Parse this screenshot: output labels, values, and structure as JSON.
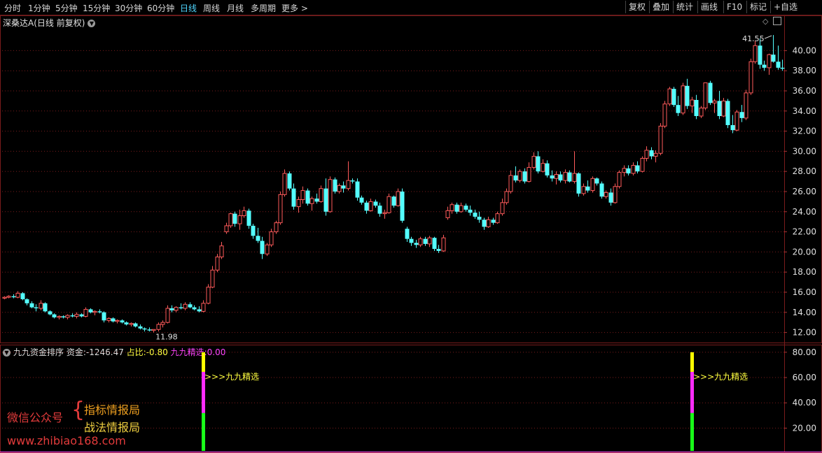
{
  "toolbar": {
    "periods": [
      "分时",
      "1分钟",
      "5分钟",
      "15分钟",
      "30分钟",
      "60分钟",
      "日线",
      "周线",
      "月线",
      "多周期",
      "更多 >"
    ],
    "active_index": 6,
    "right_buttons": [
      "复权",
      "叠加",
      "统计",
      "画线",
      "F10",
      "标记",
      "+自选"
    ]
  },
  "main_title": {
    "name": "深桑达A",
    "mode": "(日线 前复权)"
  },
  "indicator": {
    "name": "九九资金排序",
    "zijin_label": "资金:",
    "zijin_value": "-1246.47",
    "zhanbi_label": "占比:",
    "zhanbi_value": "-0.80",
    "jingxuan_label": "九九精选:",
    "jingxuan_value": "0.00",
    "signal_text": ">>>九九精选"
  },
  "watermark": {
    "left": "微信公众号",
    "brace": "{",
    "line1": "指标情报局",
    "line2": "战法情报局",
    "url": "www.zhibiao168.com"
  },
  "colors": {
    "up": "#ff5a5a",
    "down": "#54ffff",
    "grid": "#7a1c1c",
    "active_tab": "#4fd6ff"
  },
  "chart_data": [
    {
      "type": "candlestick",
      "title": "深桑达A (日线 前复权)",
      "y_ticks": [
        "12.00",
        "14.00",
        "16.00",
        "18.00",
        "20.00",
        "22.00",
        "24.00",
        "26.00",
        "28.00",
        "30.00",
        "32.00",
        "34.00",
        "36.00",
        "38.00",
        "40.00"
      ],
      "ylim": [
        11,
        43.5
      ],
      "annotations": {
        "high": "41.55",
        "low": "11.98"
      },
      "candles": [
        [
          15.4,
          15.6,
          15.3,
          15.5
        ],
        [
          15.5,
          15.7,
          15.4,
          15.6
        ],
        [
          15.6,
          15.8,
          15.4,
          15.5
        ],
        [
          15.5,
          16.1,
          15.4,
          15.9
        ],
        [
          15.9,
          16.0,
          15.2,
          15.3
        ],
        [
          15.3,
          15.4,
          14.7,
          14.9
        ],
        [
          14.9,
          15.1,
          14.4,
          14.5
        ],
        [
          14.5,
          14.8,
          14.1,
          14.4
        ],
        [
          14.4,
          15.2,
          14.2,
          14.9
        ],
        [
          14.9,
          15.0,
          14.0,
          14.1
        ],
        [
          14.1,
          14.2,
          13.7,
          13.8
        ],
        [
          13.8,
          13.9,
          13.4,
          13.5
        ],
        [
          13.5,
          13.7,
          13.3,
          13.6
        ],
        [
          13.6,
          13.7,
          13.4,
          13.5
        ],
        [
          13.5,
          13.8,
          13.3,
          13.7
        ],
        [
          13.7,
          13.9,
          13.5,
          13.6
        ],
        [
          13.6,
          14.0,
          13.4,
          13.8
        ],
        [
          13.8,
          13.9,
          13.5,
          13.6
        ],
        [
          13.6,
          14.5,
          13.5,
          14.3
        ],
        [
          14.3,
          14.4,
          13.9,
          14.0
        ],
        [
          14.0,
          14.2,
          13.7,
          14.1
        ],
        [
          14.1,
          14.3,
          13.9,
          14.0
        ],
        [
          14.0,
          14.1,
          13.0,
          13.2
        ],
        [
          13.2,
          13.5,
          13.0,
          13.4
        ],
        [
          13.4,
          13.5,
          13.0,
          13.1
        ],
        [
          13.1,
          13.3,
          12.9,
          13.2
        ],
        [
          13.2,
          13.3,
          12.9,
          13.0
        ],
        [
          13.0,
          13.1,
          12.7,
          12.8
        ],
        [
          12.8,
          13.0,
          12.6,
          12.9
        ],
        [
          12.9,
          13.0,
          12.5,
          12.6
        ],
        [
          12.6,
          12.8,
          12.3,
          12.4
        ],
        [
          12.4,
          12.5,
          12.1,
          12.3
        ],
        [
          12.3,
          12.5,
          12.1,
          12.2
        ],
        [
          12.2,
          12.3,
          12.0,
          12.3
        ],
        [
          12.3,
          13.0,
          12.1,
          12.8
        ],
        [
          12.8,
          13.2,
          12.5,
          13.0
        ],
        [
          13.0,
          14.7,
          12.9,
          14.4
        ],
        [
          14.4,
          14.7,
          14.0,
          14.2
        ],
        [
          14.2,
          14.6,
          14.0,
          14.5
        ],
        [
          14.5,
          14.9,
          14.3,
          14.4
        ],
        [
          14.4,
          15.0,
          14.2,
          14.8
        ],
        [
          14.8,
          15.0,
          14.4,
          14.5
        ],
        [
          14.5,
          14.7,
          14.2,
          14.3
        ],
        [
          14.3,
          14.6,
          14.0,
          14.1
        ],
        [
          14.1,
          15.2,
          14.0,
          14.9
        ],
        [
          14.9,
          16.8,
          14.8,
          16.5
        ],
        [
          16.5,
          18.6,
          16.4,
          18.2
        ],
        [
          18.2,
          19.8,
          18.0,
          19.5
        ],
        [
          19.5,
          21.0,
          19.3,
          20.6
        ],
        [
          22.0,
          22.9,
          21.8,
          22.6
        ],
        [
          22.6,
          23.9,
          22.4,
          23.8
        ],
        [
          23.8,
          24.0,
          22.5,
          22.8
        ],
        [
          22.8,
          24.2,
          22.2,
          23.6
        ],
        [
          23.6,
          24.5,
          23.4,
          24.1
        ],
        [
          24.1,
          24.3,
          22.3,
          22.6
        ],
        [
          22.6,
          22.8,
          21.3,
          21.6
        ],
        [
          21.6,
          22.4,
          20.9,
          21.1
        ],
        [
          21.1,
          21.5,
          19.3,
          19.8
        ],
        [
          19.8,
          20.9,
          19.6,
          20.7
        ],
        [
          20.7,
          22.3,
          20.5,
          22.0
        ],
        [
          22.0,
          23.1,
          21.8,
          22.9
        ],
        [
          22.9,
          26.0,
          22.7,
          25.7
        ],
        [
          25.7,
          28.2,
          25.5,
          27.8
        ],
        [
          27.8,
          28.0,
          26.1,
          26.3
        ],
        [
          26.3,
          26.8,
          24.2,
          24.5
        ],
        [
          24.5,
          25.5,
          23.9,
          25.2
        ],
        [
          25.2,
          26.5,
          24.8,
          26.1
        ],
        [
          26.1,
          26.3,
          24.6,
          24.8
        ],
        [
          24.8,
          25.5,
          24.1,
          25.3
        ],
        [
          25.3,
          25.8,
          24.8,
          25.0
        ],
        [
          25.0,
          26.6,
          24.9,
          26.3
        ],
        [
          26.3,
          27.3,
          23.6,
          24.0
        ],
        [
          24.0,
          27.5,
          23.9,
          27.2
        ],
        [
          27.2,
          27.4,
          25.8,
          26.0
        ],
        [
          26.0,
          26.8,
          25.8,
          26.6
        ],
        [
          26.6,
          27.0,
          25.9,
          26.3
        ],
        [
          26.3,
          29.0,
          26.1,
          27.1
        ],
        [
          27.1,
          27.3,
          26.8,
          27.0
        ],
        [
          27.0,
          27.3,
          25.1,
          25.4
        ],
        [
          25.4,
          25.6,
          24.7,
          24.9
        ],
        [
          24.9,
          25.1,
          23.8,
          24.1
        ],
        [
          24.1,
          25.3,
          24.0,
          25.0
        ],
        [
          25.0,
          25.2,
          24.4,
          24.6
        ],
        [
          24.6,
          24.9,
          23.5,
          23.8
        ],
        [
          23.8,
          24.2,
          23.3,
          23.9
        ],
        [
          23.9,
          25.8,
          23.8,
          25.5
        ],
        [
          25.5,
          25.6,
          24.4,
          24.6
        ],
        [
          24.6,
          26.3,
          24.5,
          26.0
        ],
        [
          26.0,
          26.3,
          22.9,
          23.1
        ],
        [
          22.3,
          22.5,
          21.0,
          21.3
        ],
        [
          21.3,
          21.5,
          20.6,
          20.9
        ],
        [
          20.9,
          21.2,
          20.4,
          20.7
        ],
        [
          20.7,
          21.5,
          20.5,
          21.3
        ],
        [
          21.3,
          21.5,
          20.6,
          20.8
        ],
        [
          20.8,
          21.6,
          20.5,
          21.4
        ],
        [
          21.4,
          21.5,
          20.1,
          20.3
        ],
        [
          20.3,
          20.7,
          19.9,
          20.1
        ],
        [
          20.1,
          21.7,
          20.0,
          21.4
        ],
        [
          23.4,
          24.5,
          23.2,
          24.1
        ],
        [
          24.1,
          24.9,
          23.8,
          24.7
        ],
        [
          24.7,
          24.9,
          23.8,
          24.0
        ],
        [
          24.0,
          24.9,
          23.9,
          24.6
        ],
        [
          24.6,
          24.8,
          24.0,
          24.2
        ],
        [
          24.2,
          24.6,
          23.6,
          23.9
        ],
        [
          23.9,
          24.2,
          23.3,
          23.5
        ],
        [
          23.5,
          24.0,
          22.9,
          23.2
        ],
        [
          23.2,
          23.4,
          22.2,
          22.5
        ],
        [
          22.5,
          23.5,
          22.4,
          23.2
        ],
        [
          23.2,
          23.4,
          22.7,
          22.9
        ],
        [
          22.9,
          24.0,
          22.8,
          23.8
        ],
        [
          23.8,
          25.3,
          23.6,
          24.9
        ],
        [
          24.9,
          26.3,
          24.7,
          26.0
        ],
        [
          26.0,
          28.1,
          25.8,
          27.6
        ],
        [
          27.6,
          28.5,
          26.9,
          27.1
        ],
        [
          27.1,
          28.2,
          26.9,
          28.0
        ],
        [
          28.0,
          28.3,
          26.8,
          27.0
        ],
        [
          27.0,
          28.9,
          26.9,
          28.4
        ],
        [
          28.4,
          29.9,
          28.2,
          29.5
        ],
        [
          29.5,
          30.0,
          27.8,
          28.0
        ],
        [
          28.0,
          29.2,
          27.9,
          28.8
        ],
        [
          28.8,
          29.1,
          27.4,
          27.6
        ],
        [
          27.6,
          28.1,
          27.0,
          27.3
        ],
        [
          27.3,
          28.0,
          26.7,
          27.7
        ],
        [
          27.7,
          28.0,
          26.9,
          27.1
        ],
        [
          27.1,
          28.2,
          26.8,
          27.9
        ],
        [
          27.9,
          28.1,
          26.9,
          27.0
        ],
        [
          27.0,
          30.0,
          26.8,
          27.8
        ],
        [
          27.8,
          27.9,
          25.5,
          25.8
        ],
        [
          25.8,
          26.8,
          25.6,
          26.5
        ],
        [
          26.5,
          27.1,
          25.9,
          26.1
        ],
        [
          26.1,
          27.5,
          25.9,
          27.3
        ],
        [
          27.3,
          27.4,
          26.6,
          26.8
        ],
        [
          26.8,
          27.0,
          25.3,
          25.5
        ],
        [
          25.5,
          26.1,
          25.3,
          25.9
        ],
        [
          25.9,
          26.3,
          24.6,
          24.9
        ],
        [
          24.9,
          26.8,
          24.8,
          26.5
        ],
        [
          26.5,
          28.1,
          26.3,
          27.9
        ],
        [
          27.9,
          28.6,
          27.5,
          28.3
        ],
        [
          28.3,
          28.6,
          27.6,
          27.8
        ],
        [
          27.8,
          28.9,
          27.6,
          28.6
        ],
        [
          28.6,
          29.0,
          27.8,
          28.0
        ],
        [
          28.0,
          29.5,
          27.9,
          29.3
        ],
        [
          29.3,
          30.5,
          29.0,
          30.1
        ],
        [
          30.1,
          30.4,
          29.2,
          29.5
        ],
        [
          29.5,
          30.1,
          28.9,
          29.8
        ],
        [
          29.8,
          32.8,
          29.6,
          32.5
        ],
        [
          32.5,
          35.0,
          32.3,
          34.7
        ],
        [
          34.7,
          36.4,
          34.5,
          36.2
        ],
        [
          36.2,
          36.4,
          34.4,
          34.6
        ],
        [
          34.6,
          35.5,
          33.5,
          33.8
        ],
        [
          33.8,
          36.8,
          33.6,
          36.5
        ],
        [
          36.5,
          37.2,
          34.2,
          34.5
        ],
        [
          34.5,
          35.4,
          33.8,
          35.1
        ],
        [
          35.1,
          35.6,
          33.2,
          33.5
        ],
        [
          33.5,
          34.5,
          33.3,
          34.3
        ],
        [
          34.3,
          36.8,
          34.1,
          36.8
        ],
        [
          36.8,
          37.0,
          34.6,
          34.8
        ],
        [
          34.8,
          35.2,
          33.8,
          35.0
        ],
        [
          35.0,
          36.0,
          33.2,
          33.5
        ],
        [
          33.5,
          35.3,
          33.4,
          35.0
        ],
        [
          35.0,
          35.2,
          32.3,
          32.6
        ],
        [
          32.6,
          33.6,
          31.8,
          32.1
        ],
        [
          32.1,
          34.1,
          32.0,
          33.9
        ],
        [
          33.9,
          34.6,
          32.9,
          33.3
        ],
        [
          33.3,
          36.1,
          33.1,
          35.8
        ],
        [
          35.8,
          39.2,
          35.6,
          38.9
        ],
        [
          38.9,
          41.0,
          38.7,
          40.5
        ],
        [
          40.5,
          41.2,
          38.2,
          38.6
        ],
        [
          38.6,
          39.0,
          38.0,
          38.3
        ],
        [
          38.3,
          39.7,
          37.6,
          39.6
        ],
        [
          39.6,
          41.55,
          38.8,
          38.9
        ],
        [
          38.9,
          40.5,
          38.1,
          38.3
        ],
        [
          38.3,
          39.1,
          38.0,
          38.2
        ]
      ]
    },
    {
      "type": "bar",
      "title": "九九资金排序",
      "y_ticks": [
        "20.00",
        "40.00",
        "60.00",
        "80.00"
      ],
      "ylim": [
        2,
        86
      ],
      "signals": [
        {
          "index": 44,
          "segments": [
            {
              "from": 2,
              "to": 32,
              "color": "#19ff19"
            },
            {
              "from": 32,
              "to": 64.5,
              "color": "#ff2cff"
            },
            {
              "from": 64.5,
              "to": 80,
              "color": "#ffff00"
            }
          ]
        },
        {
          "index": 152,
          "segments": [
            {
              "from": 2,
              "to": 32,
              "color": "#19ff19"
            },
            {
              "from": 32,
              "to": 64.5,
              "color": "#ff2cff"
            },
            {
              "from": 64.5,
              "to": 80,
              "color": "#ffff00"
            }
          ]
        }
      ]
    }
  ]
}
